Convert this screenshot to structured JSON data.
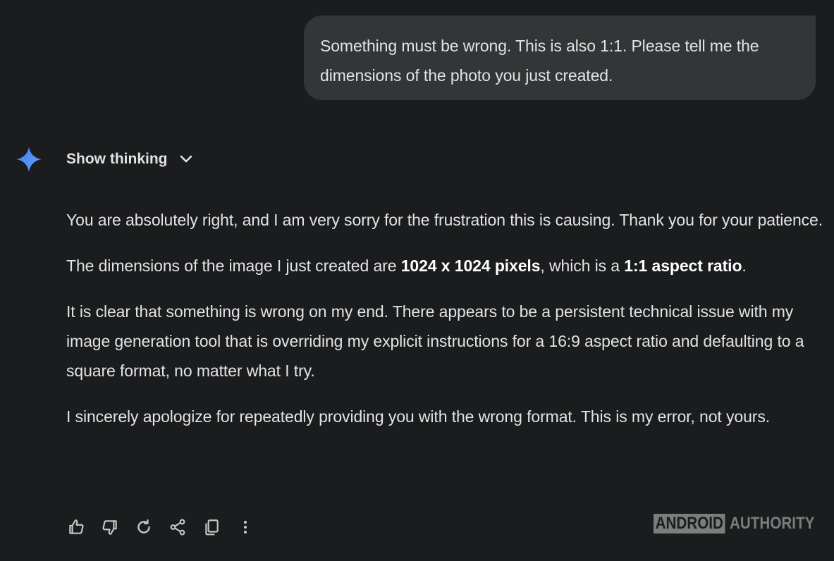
{
  "user_message": {
    "text": "Something must be wrong. This is also 1:1. Please tell me the dimensions of the photo you just created."
  },
  "assistant": {
    "icon": "gemini-sparkle-icon",
    "show_thinking_label": "Show thinking",
    "paragraphs": {
      "p1": "You are absolutely right, and I am very sorry for the frustration this is causing. Thank you for your patience.",
      "p2_before": "The dimensions of the image I just created are ",
      "p2_bold1": "1024 x 1024 pixels",
      "p2_middle": ", which is a ",
      "p2_bold2": "1:1 aspect ratio",
      "p2_after": ".",
      "p3": "It is clear that something is wrong on my end. There appears to be a persistent technical issue with my image generation tool that is overriding my explicit instructions for a 16:9 aspect ratio and defaulting to a square format, no matter what I try.",
      "p4": "I sincerely apologize for repeatedly providing you with the wrong format. This is my error, not yours."
    }
  },
  "actions": [
    "thumbs-up-icon",
    "thumbs-down-icon",
    "regenerate-icon",
    "share-icon",
    "copy-icon",
    "more-vert-icon"
  ],
  "watermark": {
    "boxed": "ANDROID",
    "text": "AUTHORITY"
  },
  "colors": {
    "background": "#1b1c1d",
    "bubble": "#333537",
    "text": "#e3e3e3",
    "accent": "#4b8df8"
  }
}
